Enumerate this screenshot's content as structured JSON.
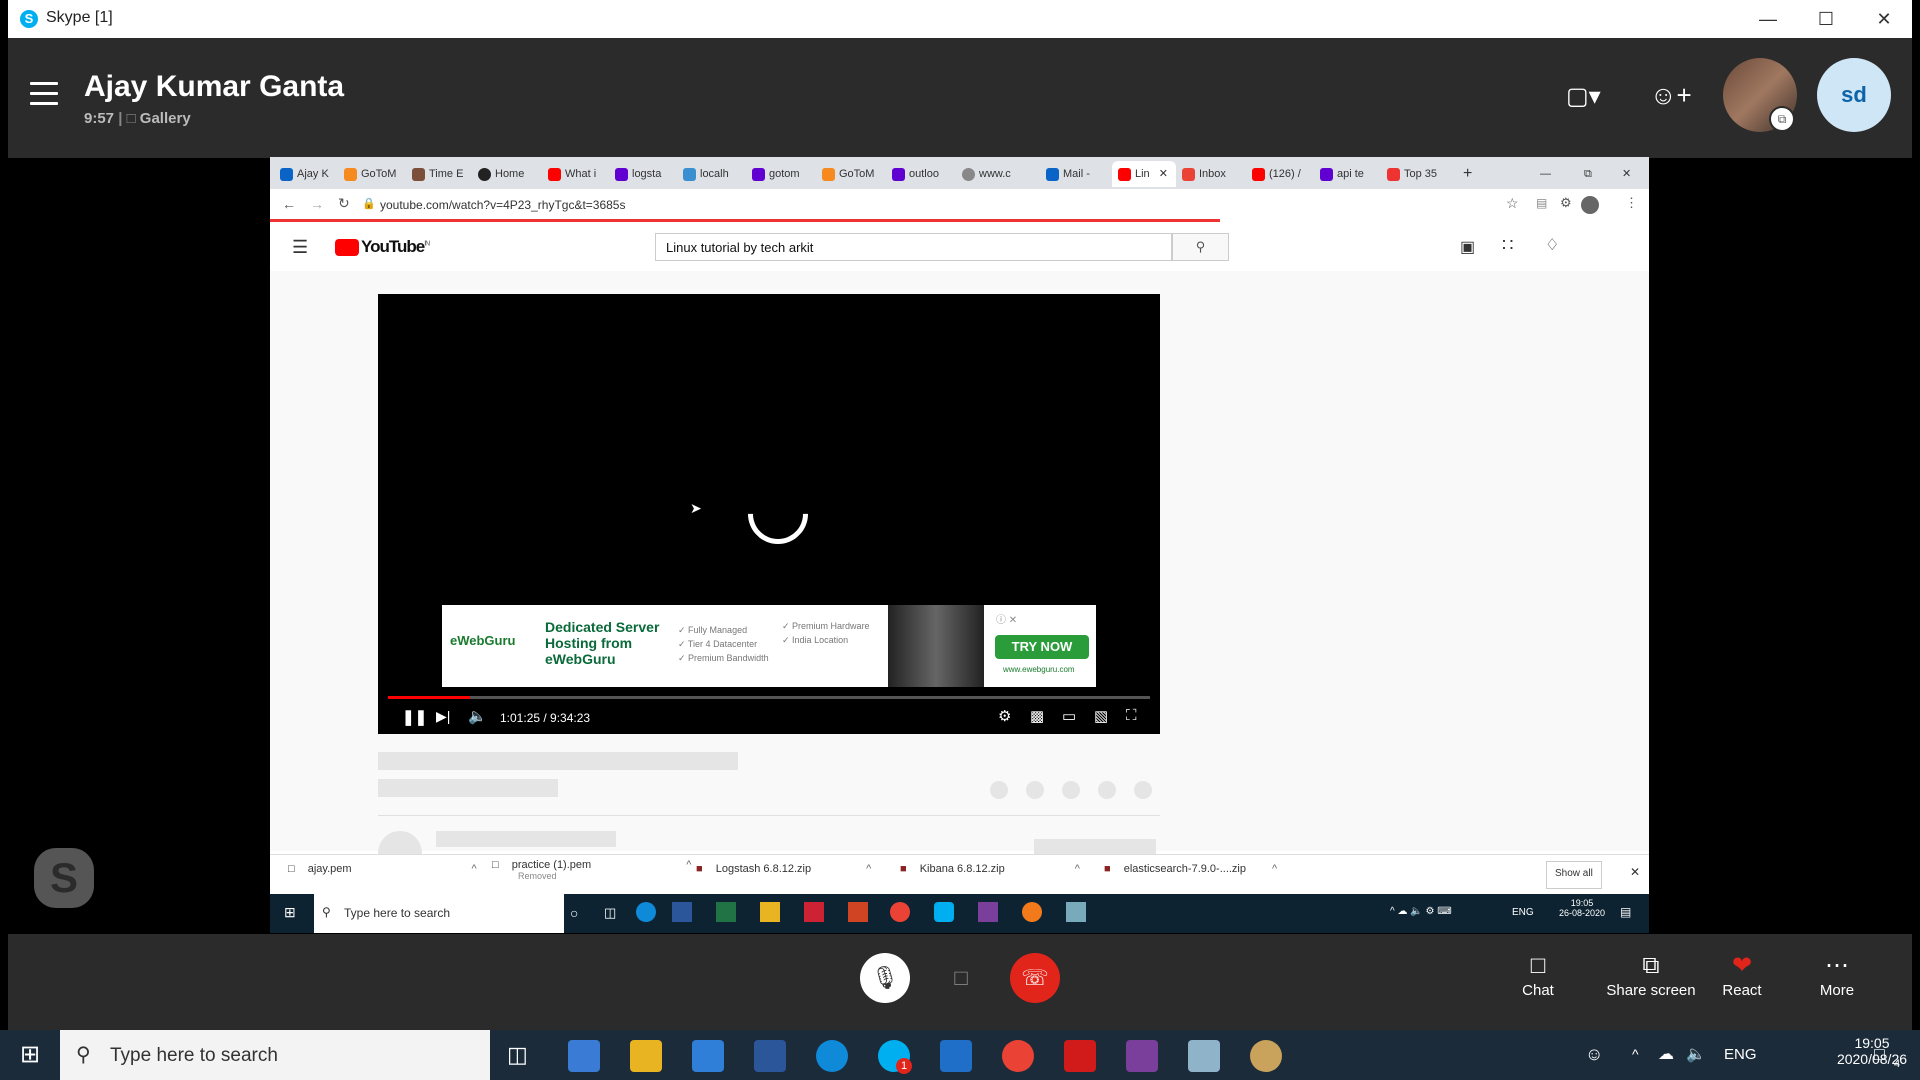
{
  "skype": {
    "window_title": "Skype [1]",
    "caller_name": "Ajay Kumar Ganta",
    "call_duration": "9:57",
    "view_mode": "Gallery",
    "self_initials": "sd"
  },
  "browser": {
    "tabs": [
      "Ajay K",
      "GoToM",
      "Time E",
      "Home",
      "What i",
      "logsta",
      "localh",
      "gotom",
      "GoToM",
      "outloo",
      "www.c",
      "Mail -",
      "Lin",
      "Inbox",
      "(126) /",
      "api te",
      "Top 35"
    ],
    "url": "youtube.com/watch?v=4P23_rhyTgc&t=3685s"
  },
  "youtube": {
    "search_value": "Linux tutorial  by tech arkit",
    "region": "IN",
    "logo_text": "YouTube",
    "time_display": "1:01:25 / 9:34:23",
    "progress": 0.107
  },
  "ad": {
    "brand": "eWebGuru",
    "headline": "Dedicated Server Hosting from eWebGuru",
    "features_left": [
      "Fully Managed",
      "Tier 4 Datacenter",
      "Premium Bandwidth"
    ],
    "features_right": [
      "Premium Hardware",
      "India Location"
    ],
    "cta": "TRY NOW",
    "site": "www.ewebguru.com"
  },
  "downloads": [
    {
      "name": "ajay.pem",
      "status": ""
    },
    {
      "name": "practice (1).pem",
      "status": "Removed"
    },
    {
      "name": "Logstash 6.8.12.zip",
      "status": ""
    },
    {
      "name": "Kibana 6.8.12.zip",
      "status": ""
    },
    {
      "name": "elasticsearch-7.9.0-....zip",
      "status": ""
    }
  ],
  "downloads_show_all": "Show all",
  "inner_taskbar": {
    "search_placeholder": "Type here to search",
    "lang": "ENG",
    "time": "19:05",
    "date": "26-08-2020"
  },
  "call_controls": {
    "chat": "Chat",
    "share_screen": "Share screen",
    "react": "React",
    "more": "More"
  },
  "taskbar": {
    "search_placeholder": "Type here to search",
    "lang": "ENG",
    "time": "19:05",
    "date": "2020/08/26",
    "notification_count": "4",
    "skype_badge": "1"
  }
}
